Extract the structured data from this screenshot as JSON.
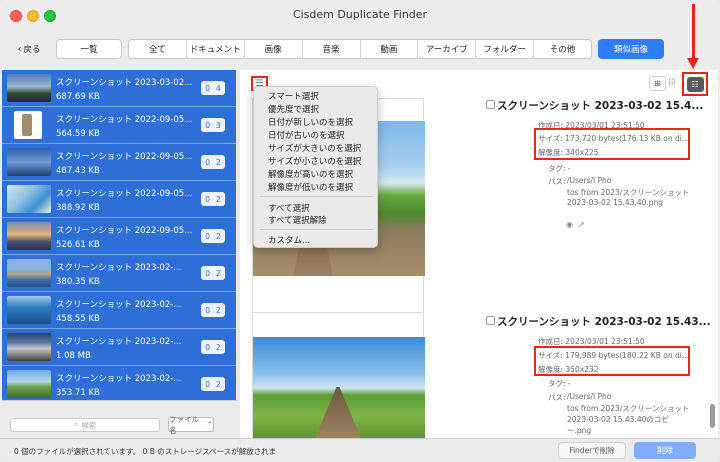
{
  "window": {
    "title": "Cisdem Duplicate Finder"
  },
  "toolbar": {
    "back_label": "戻る",
    "list_label": "一覧",
    "segments": [
      "全て",
      "ドキュメント",
      "画像",
      "音楽",
      "動画",
      "アーカイブ",
      "フォルダー",
      "その他"
    ],
    "similar_label": "類似画像"
  },
  "sidebar": {
    "items": [
      {
        "name": "スクリーンショット 2023-03-02...",
        "size": "687.69 KB",
        "count": "4",
        "icon": "image-thumbnail"
      },
      {
        "name": "スクリーンショット 2022-09-05...",
        "size": "564.59 KB",
        "count": "3",
        "icon": "image-thumbnail"
      },
      {
        "name": "スクリーンショット 2022-09-05...",
        "size": "487.43 KB",
        "count": "2",
        "icon": "image-thumbnail"
      },
      {
        "name": "スクリーンショット 2022-09-05...",
        "size": "388.92 KB",
        "count": "2",
        "icon": "image-thumbnail"
      },
      {
        "name": "スクリーンショット 2022-09-05...",
        "size": "526.61 KB",
        "count": "2",
        "icon": "image-thumbnail"
      },
      {
        "name": "スクリーンショット 2023-02-...",
        "size": "380.35 KB",
        "count": "2",
        "icon": "image-thumbnail"
      },
      {
        "name": "スクリーンショット 2023-02-...",
        "size": "458.55 KB",
        "count": "2",
        "icon": "image-thumbnail"
      },
      {
        "name": "スクリーンショット 2023-02-...",
        "size": "1.08 MB",
        "count": "2",
        "icon": "image-thumbnail"
      },
      {
        "name": "スクリーンショット 2023-02-...",
        "size": "353.71 KB",
        "count": "2",
        "icon": "image-thumbnail"
      }
    ],
    "count_prefix": "0",
    "search_placeholder": "検索",
    "sort_label": "ファイル名"
  },
  "menu": {
    "items": [
      "スマート選択",
      "優先度で選択",
      "日付が新しいのを選択",
      "日付が古いのを選択",
      "サイズが大きいのを選択",
      "サイズが小さいのを選択",
      "解像度が高いのを選択",
      "解像度が低いのを選択"
    ],
    "select_all": "すべて選択",
    "deselect_all": "すべて選択解除",
    "custom": "カスタム..."
  },
  "main": {
    "cards": [
      {
        "title": "スクリーンショット 2023-03-02 15.4...",
        "created": "作成日: 2023/03/01 23:51:50",
        "size": "サイズ: 173,720 bytes(176.13 KB on di...",
        "resolution": "解像度: 340x225",
        "tags": "タグ: -",
        "path_label": "パス:",
        "path_line1": "/Users/l                    Pho",
        "path_line2": "tos from 2023/スクリーンショット",
        "path_line3": "2023-03-02 15.43.40.png"
      },
      {
        "title": "スクリーンショット 2023-03-02 15.43...",
        "created": "作成日: 2023/03/01 23:51:50",
        "size": "サイズ: 179,989 bytes(180.22 KB on di...",
        "resolution": "解像度: 350x232",
        "tags": "タグ: -",
        "path_label": "パス:",
        "path_line1": "/Users/l                    Pho",
        "path_line2": "tos from 2023/スクリーンショット",
        "path_line3": "2023-03-02 15.43.40のコピ",
        "path_line4": "ー.png"
      }
    ]
  },
  "status": {
    "text": "0 個のファイルが選択されています。 0 B のストレージスペースが解放されま",
    "finder_delete": "Finderで削除",
    "delete": "削除"
  },
  "colors": {
    "sidebar_bg": "#2d6fd6",
    "accent": "#2f7cf6",
    "annotation": "#e5281a"
  }
}
